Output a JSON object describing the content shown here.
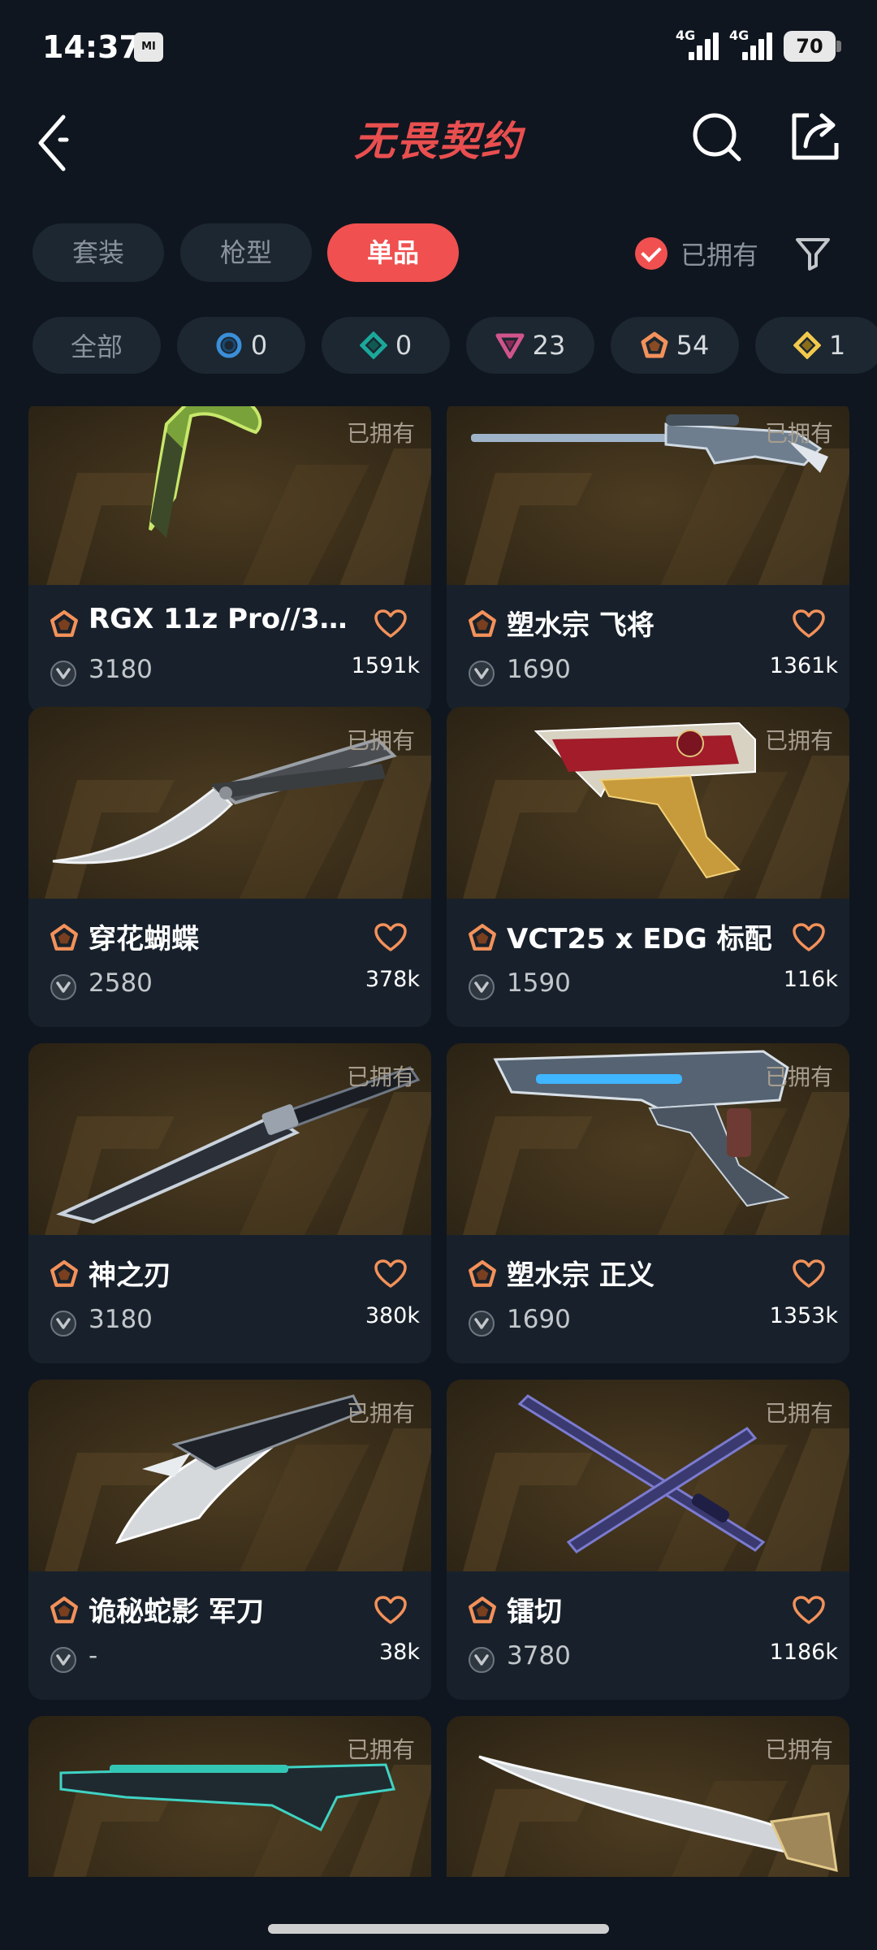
{
  "status_bar": {
    "time": "14:37",
    "mi_badge": "MI",
    "net1": "4G",
    "net2": "4G",
    "battery": "70"
  },
  "header": {
    "logo": "无畏契约",
    "back_icon": "back-arrow-icon",
    "search_icon": "search-icon",
    "share_icon": "share-icon"
  },
  "tabs": [
    {
      "label": "套装",
      "active": false
    },
    {
      "label": "枪型",
      "active": false
    },
    {
      "label": "单品",
      "active": true
    }
  ],
  "owned_filter": {
    "label": "已拥有",
    "checked": true
  },
  "rarity_filters": [
    {
      "label": "全部"
    },
    {
      "icon": "ring-blue-icon",
      "count": "0"
    },
    {
      "icon": "diamond-teal-icon",
      "count": "0"
    },
    {
      "icon": "triangle-pink-icon",
      "count": "23"
    },
    {
      "icon": "pentagon-orange-icon",
      "count": "54"
    },
    {
      "icon": "diamond-yellow-icon",
      "count": "1"
    }
  ],
  "colors": {
    "accent": "#f0504f",
    "tier_orange": "#f3915a",
    "background": "#0f1620",
    "card": "#18212b"
  },
  "owned_tag": "已拥有",
  "items": [
    {
      "name": "RGX 11z Pro//3.0...",
      "price": "3180",
      "count": "1591k",
      "owned": "已拥有",
      "weapon": "knife-green"
    },
    {
      "name": "塑水宗 飞将",
      "price": "1690",
      "count": "1361k",
      "owned": "已拥有",
      "weapon": "sniper"
    },
    {
      "name": "穿花蝴蝶",
      "price": "2580",
      "count": "378k",
      "owned": "已拥有",
      "weapon": "butterfly"
    },
    {
      "name": "VCT25 x EDG 标配",
      "price": "1590",
      "count": "116k",
      "owned": "已拥有",
      "weapon": "pistol-edg"
    },
    {
      "name": "神之刃",
      "price": "3180",
      "count": "380k",
      "owned": "已拥有",
      "weapon": "blade"
    },
    {
      "name": "塑水宗 正义",
      "price": "1690",
      "count": "1353k",
      "owned": "已拥有",
      "weapon": "pistol-blue"
    },
    {
      "name": "诡秘蛇影 军刀",
      "price": "-",
      "count": "38k",
      "owned": "已拥有",
      "weapon": "claw"
    },
    {
      "name": "镭切",
      "price": "3780",
      "count": "1186k",
      "owned": "已拥有",
      "weapon": "katana"
    },
    {
      "name": "",
      "price": "",
      "count": "",
      "owned": "已拥有",
      "weapon": "rifle-teal"
    },
    {
      "name": "",
      "price": "",
      "count": "",
      "owned": "已拥有",
      "weapon": "scimitar"
    }
  ]
}
